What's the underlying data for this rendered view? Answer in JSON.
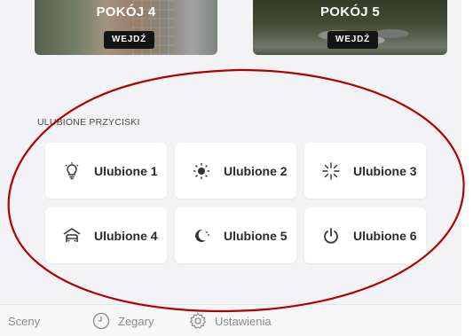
{
  "rooms": [
    {
      "title": "POKÓJ 4",
      "enter_label": "WEJDŹ"
    },
    {
      "title": "POKÓJ 5",
      "enter_label": "WEJDŹ"
    }
  ],
  "favorites": {
    "section_label": "ULUBIONE PRZYCISKI",
    "items": [
      {
        "label": "Ulubione 1",
        "icon": "bulb-icon"
      },
      {
        "label": "Ulubione 2",
        "icon": "sun-icon"
      },
      {
        "label": "Ulubione 3",
        "icon": "spark-icon"
      },
      {
        "label": "Ulubione 4",
        "icon": "garage-icon"
      },
      {
        "label": "Ulubione 5",
        "icon": "moon-icon"
      },
      {
        "label": "Ulubione 6",
        "icon": "power-icon"
      }
    ]
  },
  "nav": {
    "items": [
      {
        "label": "Sceny",
        "icon": ""
      },
      {
        "label": "Zegary",
        "icon": "clock-icon"
      },
      {
        "label": "Ustawienia",
        "icon": "gear-icon"
      }
    ]
  },
  "colors": {
    "background": "#f3f3f5",
    "card": "#ffffff",
    "annotation": "#b00000",
    "enter_button": "#141414",
    "nav_text": "#8a8a8e"
  }
}
